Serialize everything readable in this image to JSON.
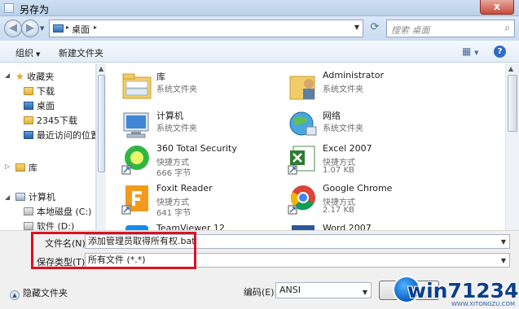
{
  "window": {
    "title": "另存为",
    "close": "x"
  },
  "address": {
    "location": "桌面",
    "search_placeholder": "搜索 桌面"
  },
  "toolbar": {
    "organize": "组织",
    "new_folder": "新建文件夹",
    "help": "?"
  },
  "sidebar": {
    "favorites": "收藏夹",
    "items": [
      "下载",
      "桌面",
      "2345下载",
      "最近访问的位置"
    ],
    "library": "库",
    "computer": "计算机",
    "drive_c": "本地磁盘 (C:)",
    "drive_d": "软件 (D:)"
  },
  "files": [
    {
      "name": "库",
      "type": "系统文件夹",
      "size": ""
    },
    {
      "name": "Administrator",
      "type": "系统文件夹",
      "size": ""
    },
    {
      "name": "计算机",
      "type": "系统文件夹",
      "size": ""
    },
    {
      "name": "网络",
      "type": "系统文件夹",
      "size": ""
    },
    {
      "name": "360 Total Security",
      "type": "快捷方式",
      "size": "666 字节"
    },
    {
      "name": "Excel 2007",
      "type": "快捷方式",
      "size": "1.07 KB"
    },
    {
      "name": "Foxit Reader",
      "type": "快捷方式",
      "size": "641 字节"
    },
    {
      "name": "Google Chrome",
      "type": "快捷方式",
      "size": "2.17 KB"
    },
    {
      "name": "TeamViewer 12",
      "type": "",
      "size": ""
    },
    {
      "name": "Word 2007",
      "type": "",
      "size": ""
    }
  ],
  "form": {
    "filename_label": "文件名(N):",
    "filename_value": "添加管理员取得所有权.bat",
    "savetype_label": "保存类型(T):",
    "savetype_value": "所有文件 (*.*)",
    "encoding_label": "编码(E):",
    "encoding_value": "ANSI",
    "hide_folders": "隐藏文件夹",
    "save_button": "保存(S)"
  },
  "watermark": {
    "text": "win71234.com",
    "sub": "WWW.XITONGZU.COM"
  },
  "colors": {
    "highlight_frame": "#e01020",
    "accent": "#2f6cc0"
  }
}
